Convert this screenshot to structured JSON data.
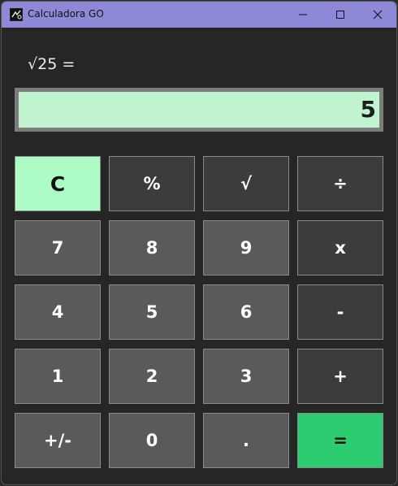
{
  "window": {
    "title": "Calculadora GO",
    "minimize_icon": "minimize-icon",
    "maximize_icon": "maximize-icon",
    "close_icon": "close-icon"
  },
  "expression": "√25 =",
  "display": "5",
  "keys": {
    "clear": "C",
    "percent": "%",
    "sqrt": "√",
    "divide": "÷",
    "seven": "7",
    "eight": "8",
    "nine": "9",
    "multiply": "x",
    "four": "4",
    "five": "5",
    "six": "6",
    "minus": "-",
    "one": "1",
    "two": "2",
    "three": "3",
    "plus": "+",
    "negate": "+/-",
    "zero": "0",
    "decimal": ".",
    "equals": "="
  },
  "colors": {
    "titlebar": "#8d89d6",
    "display_bg": "#bff4cf",
    "clear_key": "#adfcc5",
    "equals_key": "#2ecc71",
    "number_key": "#5a5a5a",
    "operator_key": "#3c3c3c"
  }
}
